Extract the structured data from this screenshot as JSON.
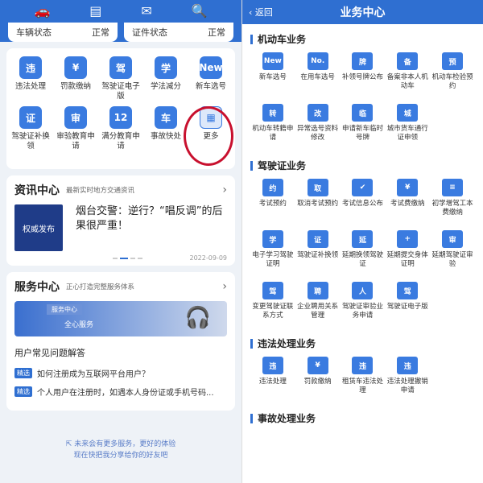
{
  "left": {
    "status": [
      {
        "label": "车辆状态",
        "value": "正常"
      },
      {
        "label": "证件状态",
        "value": "正常"
      }
    ],
    "services": [
      {
        "icon": "违",
        "label": "违法处理"
      },
      {
        "icon": "¥",
        "label": "罚款缴纳"
      },
      {
        "icon": "驾",
        "label": "驾驶证电子版"
      },
      {
        "icon": "学",
        "label": "学法减分"
      },
      {
        "icon": "New",
        "label": "新车选号"
      },
      {
        "icon": "证",
        "label": "驾驶证补换领"
      },
      {
        "icon": "审",
        "label": "审验教育申请"
      },
      {
        "icon": "12",
        "label": "满分教育申请"
      },
      {
        "icon": "车",
        "label": "事故快处"
      },
      {
        "icon": "▦",
        "label": "更多"
      }
    ],
    "news": {
      "title": "资讯中心",
      "subtitle": "最新实时地方交通资讯",
      "image_text": "权威发布",
      "headline": "烟台交警：逆行？“唱反调”的后果很严重！",
      "date": "2022-09-09"
    },
    "service_center": {
      "title": "服务中心",
      "subtitle": "正心打造完整服务体系",
      "banner_top": "服务中心",
      "banner_text": "全心服务",
      "faq_title": "用户常见问题解答",
      "tag": "精选",
      "faqs": [
        "如何注册成为互联网平台用户？",
        "个人用户在注册时，如遇本人身份证或手机号码..."
      ]
    },
    "footer_line1": "未来会有更多服务，更好的体验",
    "footer_line2": "现在快把我分享给你的好友吧"
  },
  "right": {
    "back": "返回",
    "title": "业务中心",
    "sections": [
      {
        "title": "机动车业务",
        "items": [
          {
            "icon": "New",
            "label": "新车选号"
          },
          {
            "icon": "No.",
            "label": "在用车选号"
          },
          {
            "icon": "牌",
            "label": "补领号牌公布"
          },
          {
            "icon": "备",
            "label": "备案非本人机动车"
          },
          {
            "icon": "预",
            "label": "机动车检验预约"
          },
          {
            "icon": "转",
            "label": "机动车转籍申请"
          },
          {
            "icon": "改",
            "label": "异常选号资料修改"
          },
          {
            "icon": "临",
            "label": "申请新车临时号牌"
          },
          {
            "icon": "城",
            "label": "城市货车通行证申领"
          }
        ]
      },
      {
        "title": "驾驶证业务",
        "items": [
          {
            "icon": "约",
            "label": "考试预约"
          },
          {
            "icon": "取",
            "label": "取消考试预约"
          },
          {
            "icon": "✔",
            "label": "考试信息公布"
          },
          {
            "icon": "¥",
            "label": "考试费缴纳"
          },
          {
            "icon": "≡",
            "label": "初学增驾工本费缴纳"
          },
          {
            "icon": "学",
            "label": "电子学习驾驶证明"
          },
          {
            "icon": "证",
            "label": "驾驶证补换领"
          },
          {
            "icon": "延",
            "label": "延期换领驾驶证"
          },
          {
            "icon": "+",
            "label": "延期提交身体证明"
          },
          {
            "icon": "审",
            "label": "延期驾驶证审验"
          },
          {
            "icon": "驾",
            "label": "变更驾驶证联系方式"
          },
          {
            "icon": "聘",
            "label": "企业聘用关系管理"
          },
          {
            "icon": "人",
            "label": "驾驶证审验业务申请"
          },
          {
            "icon": "驾",
            "label": "驾驶证电子版"
          }
        ]
      },
      {
        "title": "违法处理业务",
        "items": [
          {
            "icon": "违",
            "label": "违法处理"
          },
          {
            "icon": "¥",
            "label": "罚款缴纳"
          },
          {
            "icon": "违",
            "label": "租赁车违法处理"
          },
          {
            "icon": "违",
            "label": "违法处理撤销申请"
          }
        ]
      },
      {
        "title": "事故处理业务",
        "items": []
      }
    ]
  },
  "colors": {
    "accent": "#2f6fd1",
    "highlight": "#c8102e"
  }
}
